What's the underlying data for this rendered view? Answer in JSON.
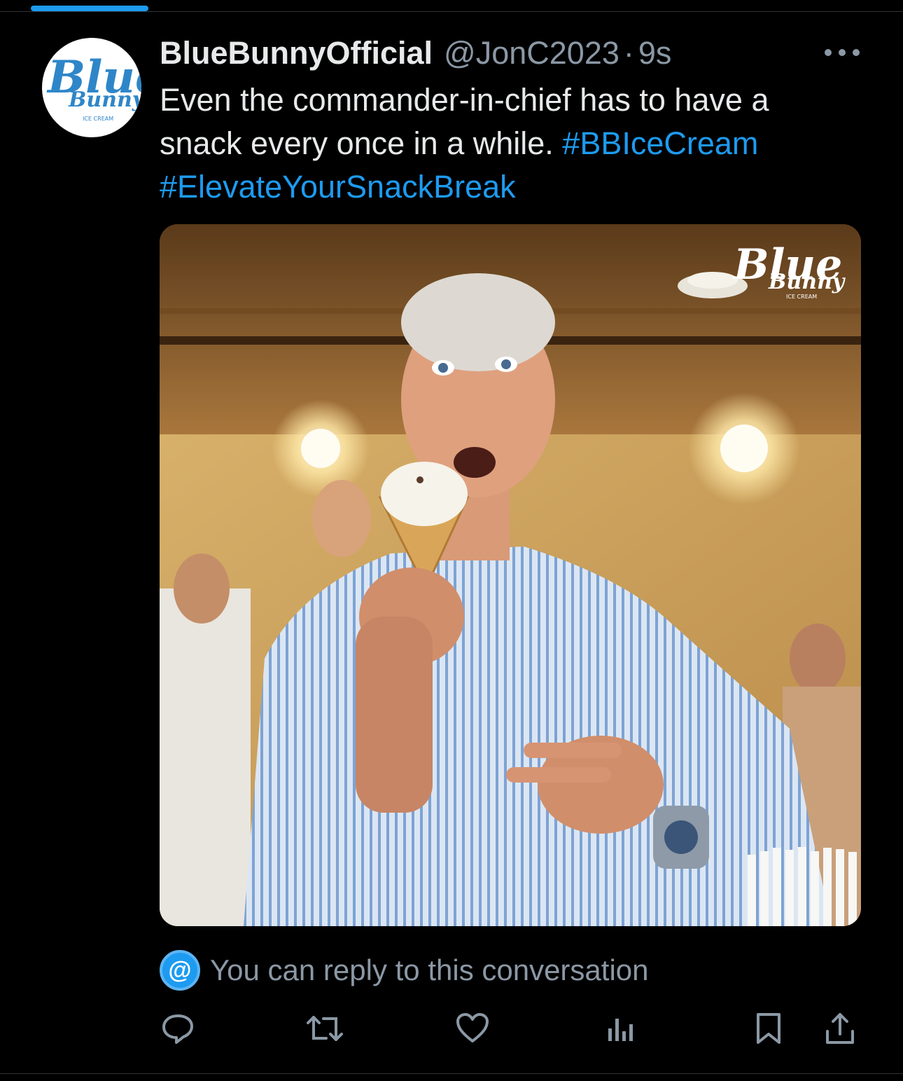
{
  "tweet": {
    "display_name": "BlueBunnyOfficial",
    "handle": "@JonC2023",
    "separator": "·",
    "time": "9s",
    "text_plain": "Even the commander-in-chief has to have a snack every once in a while. ",
    "hashtags": [
      "#BBIceCream",
      "#ElevateYourSnackBreak"
    ]
  },
  "avatar": {
    "brand_lines": [
      "Blue",
      "Bunny"
    ],
    "brand_tagline": "ICE CREAM"
  },
  "media": {
    "watermark_lines": [
      "Blue",
      "Bunny"
    ],
    "watermark_tagline": "ICE CREAM"
  },
  "reply_notice": {
    "icon_text": "@",
    "text": "You can reply to this conversation"
  },
  "colors": {
    "background": "#000000",
    "accent": "#1d9bf0",
    "text_primary": "#e7e9ea",
    "text_secondary": "#8b98a5",
    "brand_blue": "#2e86c8"
  },
  "icons": {
    "more": "more-horizontal-icon",
    "reply": "reply-icon",
    "retweet": "retweet-icon",
    "like": "like-icon",
    "views": "views-icon",
    "bookmark": "bookmark-icon",
    "share": "share-icon"
  }
}
